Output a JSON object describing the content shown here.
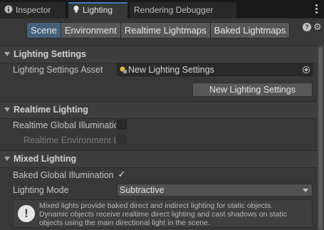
{
  "tabs": [
    {
      "label": "Inspector",
      "icon": "info-icon"
    },
    {
      "label": "Lighting",
      "icon": "lightbulb-icon"
    },
    {
      "label": "Rendering Debugger"
    }
  ],
  "toolbar": {
    "segments": [
      "Scene",
      "Environment",
      "Realtime Lightmaps",
      "Baked Lightmaps"
    ],
    "selected": "Scene"
  },
  "lighting_settings": {
    "header": "Lighting Settings",
    "asset_label": "Lighting Settings Asset",
    "asset_value": "New Lighting Settings",
    "new_button": "New Lighting Settings"
  },
  "realtime_lighting": {
    "header": "Realtime Lighting",
    "gi_label": "Realtime Global Illuminatic",
    "gi_checked": false,
    "env_label": "Realtime Environment L",
    "env_checked": false
  },
  "mixed_lighting": {
    "header": "Mixed Lighting",
    "baked_gi_label": "Baked Global Illumination",
    "baked_gi_checked": true,
    "mode_label": "Lighting Mode",
    "mode_value": "Subtractive",
    "help_line1": "Mixed lights provide baked direct and indirect lighting for static objects.",
    "help_line2": "Dynamic objects receive realtime direct lighting and cast shadows on static",
    "help_line3": "objects using the main directional light in the scene."
  },
  "colors": {
    "accent": "#3a79bb",
    "selected_segment": "#46607c",
    "panel_bg": "#383838"
  }
}
